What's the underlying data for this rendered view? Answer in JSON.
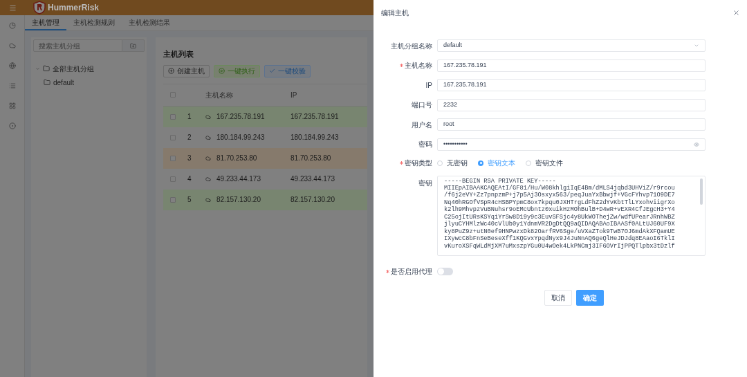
{
  "app": {
    "brand": "HummerRisk",
    "tabs": [
      {
        "label": "主机管理",
        "selected": true
      },
      {
        "label": "主机检测规则",
        "selected": false
      },
      {
        "label": "主机检测结果",
        "selected": false
      }
    ],
    "group_search": {
      "placeholder": "搜索主机分组"
    },
    "tree": [
      {
        "label": "全部主机分组",
        "expanded": true,
        "children": [
          {
            "label": "default"
          }
        ]
      }
    ],
    "list_title": "主机列表",
    "actions": [
      {
        "kind": "create",
        "label": "创建主机"
      },
      {
        "kind": "run",
        "label": "一键执行"
      },
      {
        "kind": "verify",
        "label": "一键校验"
      }
    ],
    "table": {
      "columns": [
        "主机名称",
        "IP"
      ],
      "header_checked": false,
      "rows": [
        {
          "index": "1",
          "name": "167.235.78.191",
          "ip": "167.235.78.191",
          "color": "#788570",
          "checked": false
        },
        {
          "index": "2",
          "name": "180.184.99.243",
          "ip": "180.184.99.243",
          "color": "#808080",
          "checked": false
        },
        {
          "index": "3",
          "name": "81.70.253.80",
          "ip": "81.70.253.80",
          "color": "#867a6c",
          "checked": false
        },
        {
          "index": "4",
          "name": "49.233.44.173",
          "ip": "49.233.44.173",
          "color": "#808080",
          "checked": false
        },
        {
          "index": "5",
          "name": "82.157.130.20",
          "ip": "82.157.130.20",
          "color": "#788570",
          "checked": false
        }
      ]
    }
  },
  "drawer": {
    "title": "编辑主机",
    "fields": [
      {
        "kind": "select",
        "label": "主机分组名称",
        "required": false,
        "value": "default"
      },
      {
        "kind": "text",
        "label": "主机名称",
        "required": true,
        "value": "167.235.78.191"
      },
      {
        "kind": "text",
        "label": "IP",
        "required": false,
        "value": "167.235.78.191"
      },
      {
        "kind": "text",
        "label": "端口号",
        "required": false,
        "value": "2232"
      },
      {
        "kind": "text",
        "label": "用户名",
        "required": false,
        "value": "root"
      },
      {
        "kind": "password",
        "label": "密码",
        "required": false,
        "value": "•••••••••••"
      }
    ],
    "key_type": {
      "label": "密钥类型",
      "required": true,
      "options": [
        {
          "label": "无密钥",
          "selected": false
        },
        {
          "label": "密钥文本",
          "selected": true
        },
        {
          "label": "密钥文件",
          "selected": false
        }
      ]
    },
    "key": {
      "label": "密钥",
      "lines": [
        "-----BEGIN RSA PRIVATE KEY-----",
        "MIIEpAIBAAKCAQEAtI/GF81/Hu/W08khlgiIqE4Bm/dMLS4jqbd3UHViZ/r9rcou",
        "/f6j2eVY+Zz7pnpzmP+j7p5Aj3Osxyx563/peqJuaYxBbwjf+VGcFYhvp71O9DE7",
        "Nq40hRGOfVSpR4cHSBPYpmC8ox7kpqu0JXHTrgLdFhZ2dYvKbtTlLYxohviigrXo",
        "k2lh9MhvpzVuBNuhsr9oEMcUbntz0xuikHzMOhBulB+D4wR+vEXR4CfJEgcH3+Y4",
        "C25ojItURsKSYqiYrSw8D19y9c3EuvSFSjc4y8UkWOThejZw/wdfUPearJRnhWBZ",
        "jlyuCYHMlzWc40cVlUb0y1YdnmVR2DgDtQQ9aQIDAQABAoIBAASf0ALtUJ60UF9X",
        "ky8PuZ9z+utN0ef9HNPwzxDk82OarfRV6Sge/uVXaZTok9TwB7OJ6mdAkXFQamUE",
        "IXywcC8bFnSeBeseXff1KQGvxYpqdNyx9J4JuNnAQ6geQlHeJDJdq8EAaoI6TklI",
        "vKuroXSFqWLdMjXM7uMxszpYGu0U4wOek4LkPNCmj3IF6OVrIjPPQTlpbx3tDzlf"
      ]
    },
    "proxy": {
      "label": "是否启用代理",
      "required": true,
      "on": false
    },
    "buttons": [
      {
        "kind": "cancel",
        "label": "取消"
      },
      {
        "kind": "confirm",
        "label": "确定"
      }
    ]
  }
}
